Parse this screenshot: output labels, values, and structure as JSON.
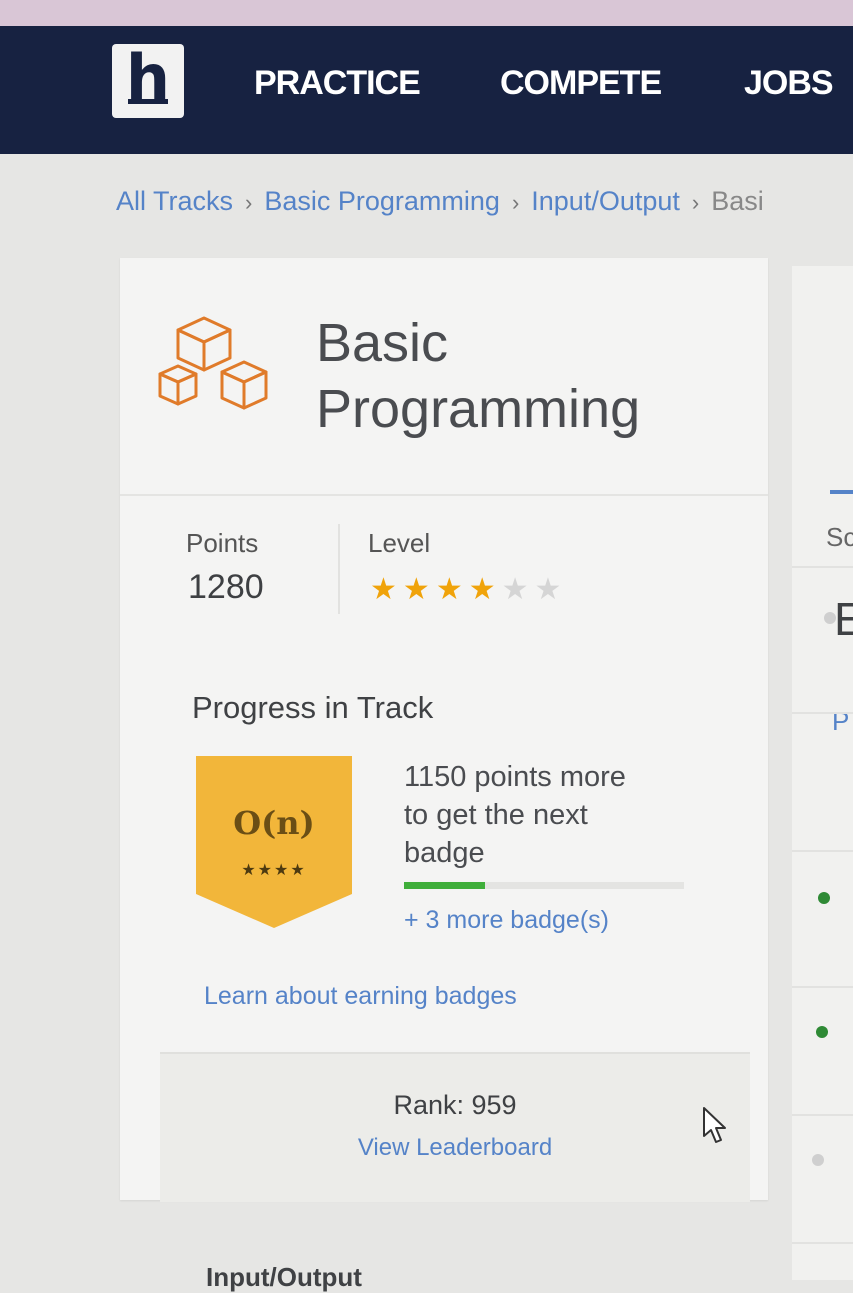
{
  "navbar": {
    "logo_letter": "h",
    "items": [
      "PRACTICE",
      "COMPETE",
      "JOBS"
    ],
    "background_color": "#172241"
  },
  "breadcrumb": [
    "All Tracks",
    "Basic Programming",
    "Input/Output",
    "Basi"
  ],
  "track": {
    "title_line1": "Basic",
    "title_line2": "Programming",
    "icon": "cubes-icon",
    "points_label": "Points",
    "points_value": "1280",
    "level_label": "Level",
    "level_stars_filled": 4,
    "level_stars_total": 6
  },
  "progress": {
    "heading": "Progress in Track",
    "badge_text": "O(n)",
    "badge_stars": "★★★★",
    "next_badge_line1": "1150 points more",
    "next_badge_line2": "to get the next",
    "next_badge_line3": "badge",
    "progress_fraction": 0.29,
    "more_badges": "+ 3 more badge(s)",
    "learn_link": "Learn about earning badges"
  },
  "rank": {
    "text": "Rank: 959",
    "leaderboard_link": "View Leaderboard"
  },
  "right_panel": {
    "letter": "E",
    "tab": "P",
    "label": "Sc"
  },
  "section_peek": "Input/Output",
  "colors": {
    "accent": "#5583c8",
    "star": "#f0a30a",
    "badge": "#f2b63a",
    "progress": "#3fae3a",
    "icon": "#e07b2a"
  }
}
